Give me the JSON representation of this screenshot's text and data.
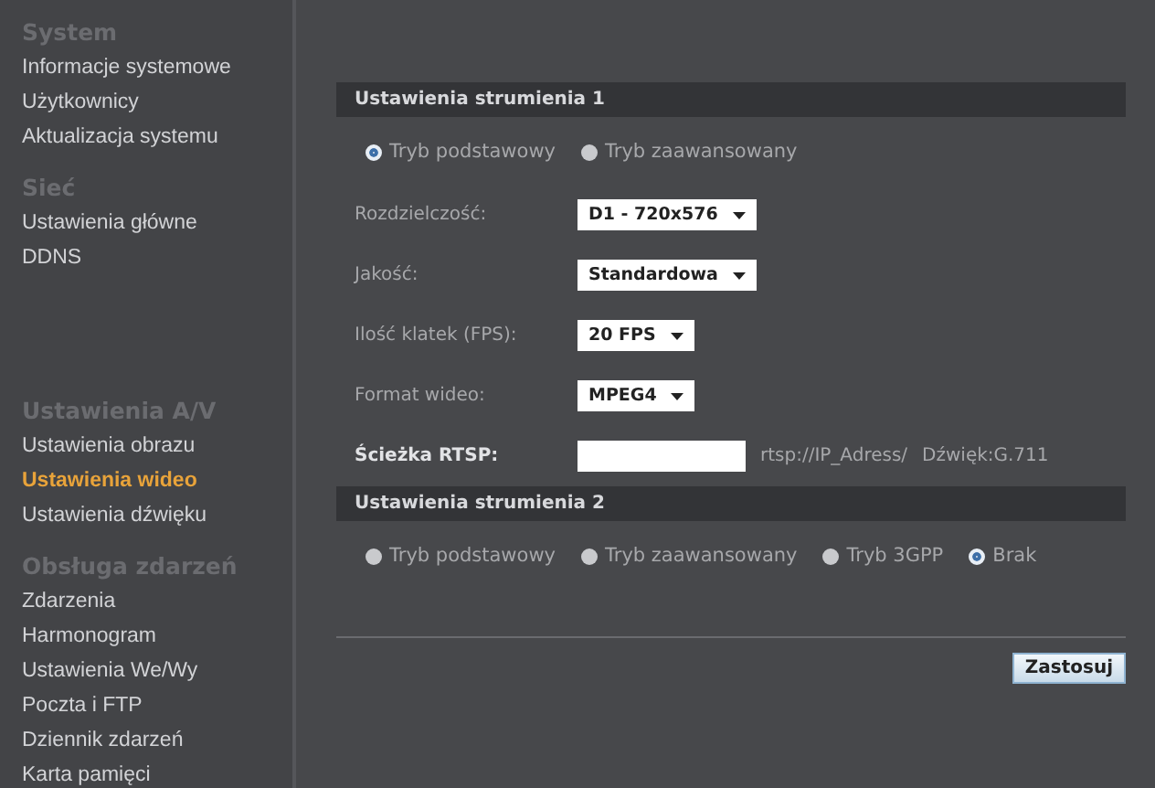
{
  "sidebar": {
    "groups": [
      {
        "title": "System",
        "items": [
          {
            "label": "Informacje systemowe",
            "selected": false
          },
          {
            "label": "Użytkownicy",
            "selected": false
          },
          {
            "label": "Aktualizacja systemu",
            "selected": false
          }
        ]
      },
      {
        "title": "Sieć",
        "items": [
          {
            "label": "Ustawienia główne",
            "selected": false
          },
          {
            "label": "DDNS",
            "selected": false
          }
        ]
      },
      {
        "title": "Ustawienia A/V",
        "items": [
          {
            "label": "Ustawienia obrazu",
            "selected": false
          },
          {
            "label": "Ustawienia wideo",
            "selected": true
          },
          {
            "label": "Ustawienia dźwięku",
            "selected": false
          }
        ]
      },
      {
        "title": "Obsługa zdarzeń",
        "items": [
          {
            "label": "Zdarzenia",
            "selected": false
          },
          {
            "label": "Harmonogram",
            "selected": false
          },
          {
            "label": "Ustawienia We/Wy",
            "selected": false
          },
          {
            "label": "Poczta i FTP",
            "selected": false
          },
          {
            "label": "Dziennik zdarzeń",
            "selected": false
          },
          {
            "label": "Karta pamięci",
            "selected": false
          }
        ]
      }
    ]
  },
  "streams": [
    {
      "title": "Ustawienia strumienia 1",
      "modes": [
        {
          "label": "Tryb podstawowy",
          "selected": true
        },
        {
          "label": "Tryb zaawansowany",
          "selected": false
        }
      ],
      "fields": [
        {
          "kind": "select",
          "label": "Rozdzielczość:",
          "value": "D1 - 720x576"
        },
        {
          "kind": "select",
          "label": "Jakość:",
          "value": "Standardowa"
        },
        {
          "kind": "select",
          "label": "Ilość klatek (FPS):",
          "value": "20 FPS"
        },
        {
          "kind": "select",
          "label": "Format wideo:",
          "value": "MPEG4"
        },
        {
          "kind": "text",
          "label": "Ścieżka RTSP:",
          "notes": [
            "rtsp://IP_Adress/",
            "Dźwięk:G.711"
          ]
        }
      ]
    },
    {
      "title": "Ustawienia strumienia 2",
      "modes": [
        {
          "label": "Tryb podstawowy",
          "selected": false
        },
        {
          "label": "Tryb zaawansowany",
          "selected": false
        },
        {
          "label": "Tryb 3GPP",
          "selected": false
        },
        {
          "label": "Brak",
          "selected": true
        }
      ]
    }
  ],
  "apply_button": "Zastosuj"
}
